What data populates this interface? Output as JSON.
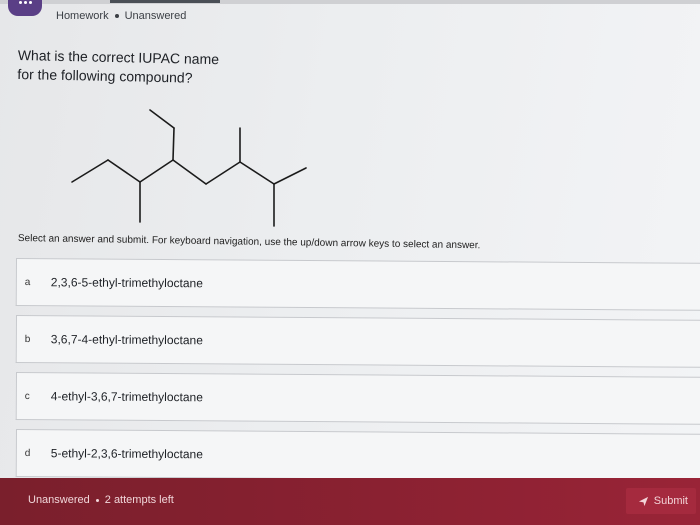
{
  "breadcrumb": {
    "section": "Homework",
    "status": "Unanswered"
  },
  "question": {
    "line1": "What is the correct IUPAC name",
    "line2": "for the following compound?"
  },
  "instruction": "Select an answer and submit. For keyboard navigation, use the up/down arrow keys to select an answer.",
  "options": [
    {
      "letter": "a",
      "text": "2,3,6-5-ethyl-trimethyloctane"
    },
    {
      "letter": "b",
      "text": "3,6,7-4-ethyl-trimethyloctane"
    },
    {
      "letter": "c",
      "text": "4-ethyl-3,6,7-trimethyloctane"
    },
    {
      "letter": "d",
      "text": "5-ethyl-2,3,6-trimethyloctane"
    }
  ],
  "footer": {
    "status": "Unanswered",
    "attempts": "2 attempts left",
    "submit_label": "Submit"
  },
  "icons": {
    "app": "app-menu-icon",
    "submit": "send-arrow-icon"
  },
  "colors": {
    "footer": "#8a2131",
    "app_badge": "#5a3f86"
  }
}
